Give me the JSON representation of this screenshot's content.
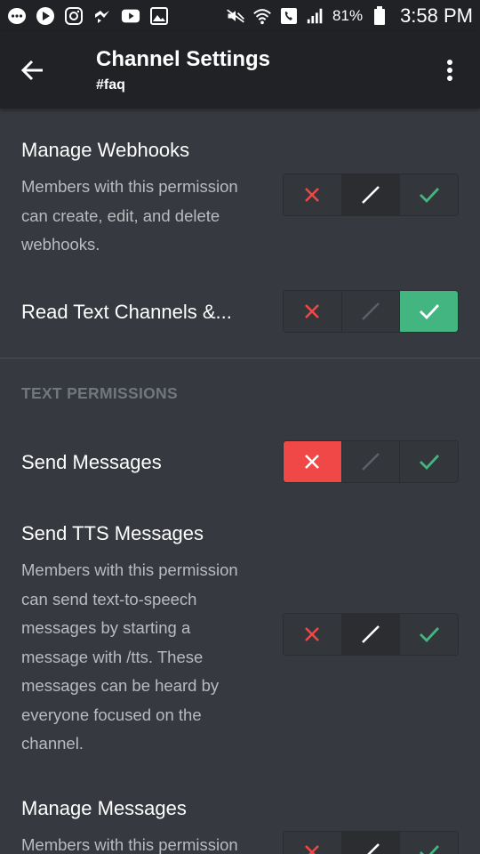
{
  "status_bar": {
    "battery_percent": "81%",
    "time": "3:58 PM",
    "icons": [
      "chat-icon",
      "play-icon",
      "instagram-icon",
      "messenger-icon",
      "youtube-icon",
      "gallery-icon",
      "mute-icon",
      "wifi-icon",
      "phone-icon",
      "signal-icon",
      "battery-icon"
    ]
  },
  "app_bar": {
    "title": "Channel Settings",
    "subtitle": "#faq",
    "back_icon": "arrow-left-icon",
    "menu_icon": "more-vert-icon"
  },
  "colors": {
    "deny": "#f04747",
    "allow": "#43b581",
    "neutral": "#ffffff",
    "background": "#36393f",
    "bar": "#202225"
  },
  "permissions": {
    "manage_webhooks": {
      "title": "Manage Webhooks",
      "description": "Members with this permission can create, edit, and delete webhooks.",
      "state": "neutral"
    },
    "read_text_channels": {
      "title": "Read Text Channels &...",
      "state": "allow"
    },
    "section_text": "TEXT PERMISSIONS",
    "send_messages": {
      "title": "Send Messages",
      "state": "deny"
    },
    "send_tts": {
      "title": "Send TTS Messages",
      "description": "Members with this permission can send text-to-speech messages by starting a message with /tts. These messages can be heard by everyone focused on the channel.",
      "state": "neutral"
    },
    "manage_messages": {
      "title": "Manage Messages",
      "description": "Members with this permission",
      "state": "neutral"
    }
  }
}
